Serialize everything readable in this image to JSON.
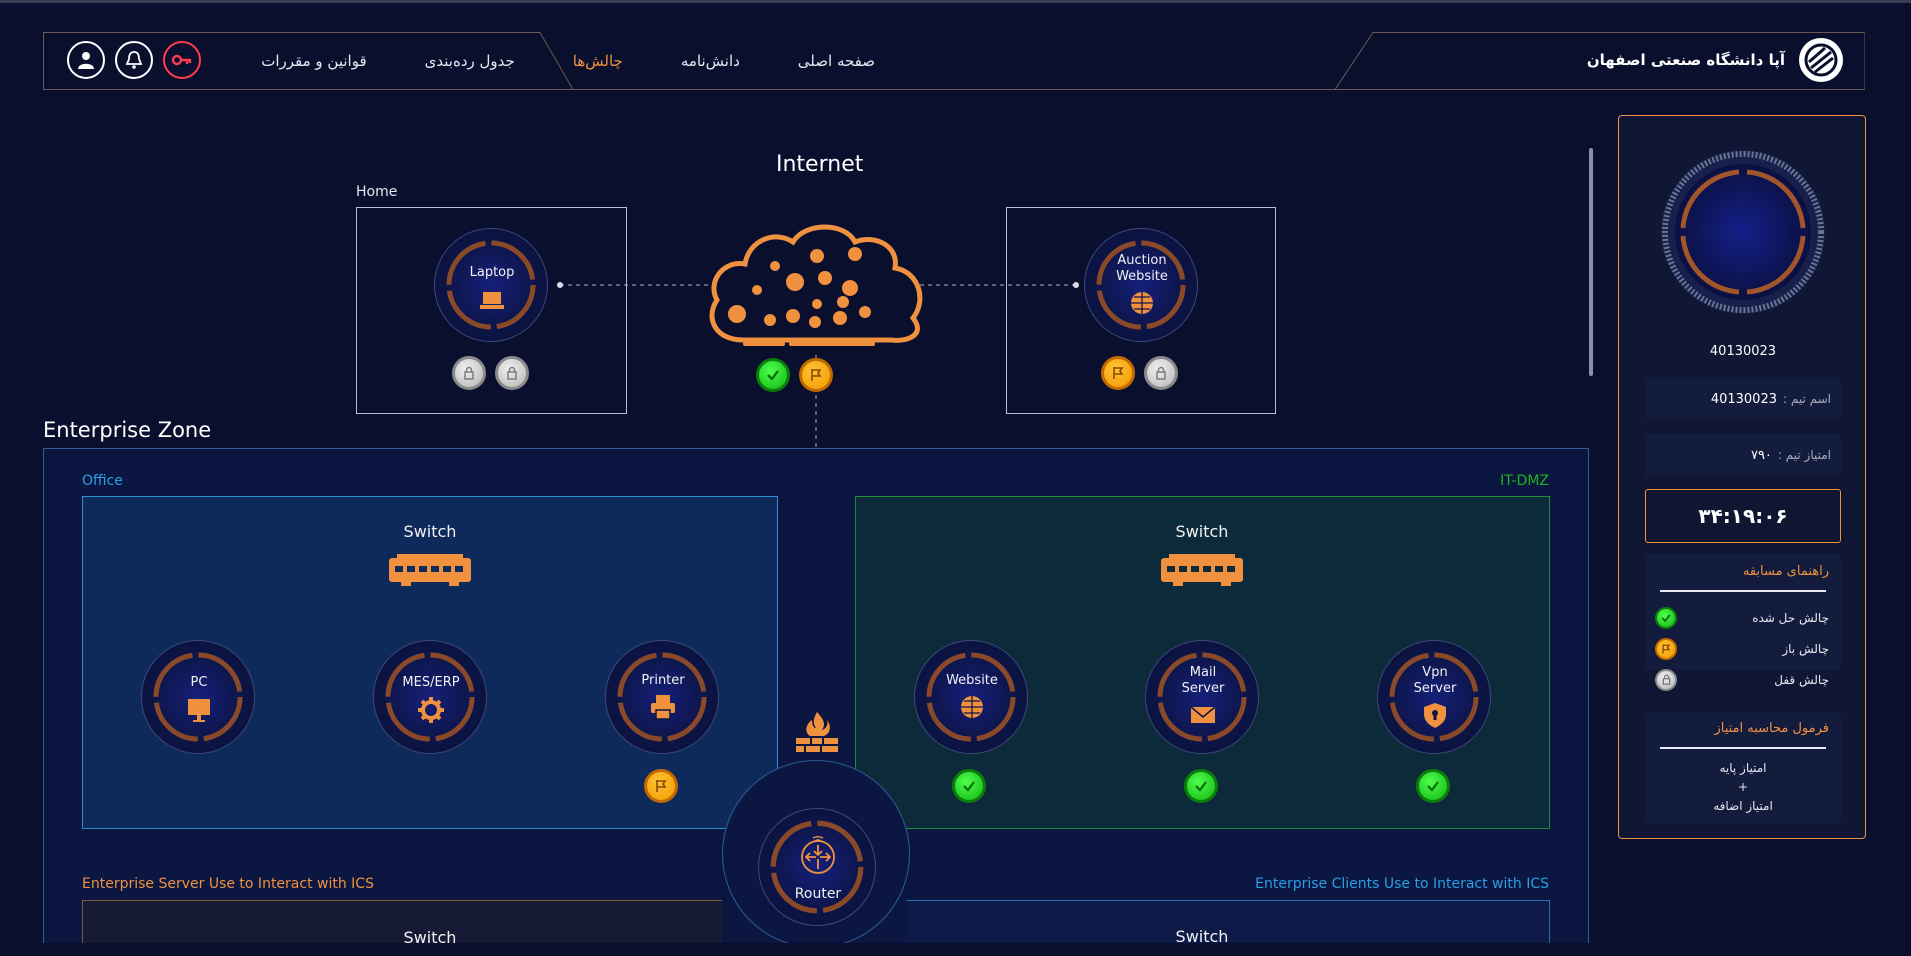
{
  "nav": {
    "brand": "آپا دانشگاه صنعتی اصفهان",
    "links": [
      "صفحه اصلی",
      "دانش‌نامه",
      "چالش‌ها",
      "جدول رده‌بندی",
      "قوانین و مقررات"
    ],
    "active_index": 2
  },
  "map": {
    "internet": "Internet",
    "home": "Home",
    "enterprise_zone": "Enterprise Zone",
    "office": "Office",
    "it_dmz": "IT-DMZ",
    "ics_server": "Enterprise Server Use to Interact with ICS",
    "ics_clients": "Enterprise Clients Use to Interact with ICS",
    "switch": "Switch",
    "router": "Router",
    "nodes": {
      "laptop": "Laptop",
      "auction": [
        "Auction",
        "Website"
      ],
      "pc": "PC",
      "mes": "MES/ERP",
      "printer": "Printer",
      "website": "Website",
      "mail": [
        "Mail",
        "Server"
      ],
      "vpn": [
        "Vpn",
        "Server"
      ]
    }
  },
  "sidebar": {
    "team_id": "40130023",
    "team_name_label": "اسم تیم :",
    "team_name": "40130023",
    "team_score_label": "امتیاز تیم :",
    "team_score": "۷۹۰",
    "timer": "۳۴:۱۹:۰۶",
    "guide_title": "راهنمای مسابقه",
    "guide": [
      "چالش حل شده",
      "چالش باز",
      "چالش قفل"
    ],
    "formula_title": "فرمول محاسبه امتیاز",
    "formula": [
      "امتیاز پایه",
      "+",
      "امتیاز اضافه"
    ]
  },
  "colors": {
    "accent": "#f0913f",
    "bg": "#0a0f2e",
    "office": "#1a8fd6",
    "dmz": "#1db31d",
    "solved": "#22c322",
    "open": "#f7a800",
    "locked": "#c9c9c9"
  }
}
